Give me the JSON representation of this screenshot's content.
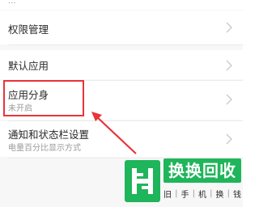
{
  "settings": {
    "top_cut_text": "...",
    "items": [
      {
        "title": "权限管理",
        "subtitle": ""
      },
      {
        "title": "默认应用",
        "subtitle": ""
      },
      {
        "title": "应用分身",
        "subtitle": "未开启"
      },
      {
        "title": "通知和状态栏设置",
        "subtitle": "电量百分比显示方式"
      }
    ]
  },
  "annotation": {
    "box_color": "#e8343a"
  },
  "watermark": {
    "title": "换换回收",
    "tags": [
      "旧",
      "手",
      "机",
      "换",
      "钱"
    ],
    "brand_color": "#1fb55a"
  },
  "icons": {
    "chevron": "chevron-right-icon",
    "logo": "huanhuan-logo-icon"
  }
}
